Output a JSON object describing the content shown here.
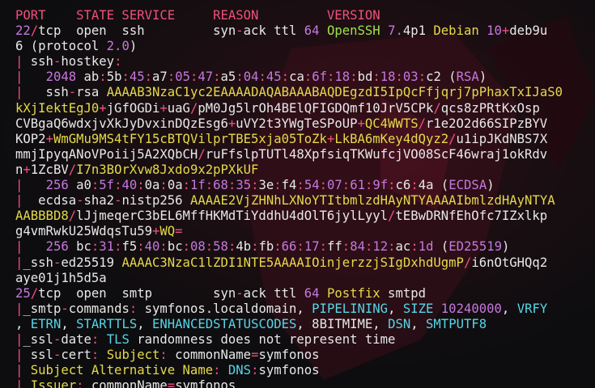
{
  "colors": {
    "background": "#0d0d0f",
    "text": "#e8e8e8",
    "red": "#f0507a",
    "purple": "#c678dd",
    "cyan": "#56d6e6",
    "green": "#a0e04a",
    "yellow": "#e5d94a"
  },
  "lines": [
    [
      [
        "PORT    STATE SERVICE     REASON         VERSION",
        "r"
      ]
    ],
    [
      [
        "22",
        "p"
      ],
      [
        "/",
        "r"
      ],
      [
        "tcp  open  ssh         syn",
        "w"
      ],
      [
        "-",
        "r"
      ],
      [
        "ack ttl ",
        "w"
      ],
      [
        "64",
        "p"
      ],
      [
        " OpenSSH ",
        "g"
      ],
      [
        "7.",
        "p"
      ],
      [
        "4p1 ",
        "w"
      ],
      [
        "Debian ",
        "y"
      ],
      [
        "10",
        "p"
      ],
      [
        "+",
        "r"
      ],
      [
        "deb9u",
        "w"
      ]
    ],
    [
      [
        "6 (protocol ",
        "w"
      ],
      [
        "2.0",
        "p"
      ],
      [
        ")",
        "w"
      ]
    ],
    [
      [
        "| ",
        "r"
      ],
      [
        "ssh",
        "w"
      ],
      [
        "-",
        "r"
      ],
      [
        "hostkey",
        "w"
      ],
      [
        ":",
        "r"
      ]
    ],
    [
      [
        "|   ",
        "r"
      ],
      [
        "2048",
        "p"
      ],
      [
        " ab",
        "w"
      ],
      [
        ":",
        "r"
      ],
      [
        "5b",
        "w"
      ],
      [
        ":",
        "r"
      ],
      [
        "45",
        "p"
      ],
      [
        ":",
        "r"
      ],
      [
        "a7",
        "w"
      ],
      [
        ":",
        "r"
      ],
      [
        "05",
        "p"
      ],
      [
        ":",
        "r"
      ],
      [
        "47",
        "p"
      ],
      [
        ":",
        "r"
      ],
      [
        "a5",
        "w"
      ],
      [
        ":",
        "r"
      ],
      [
        "04",
        "p"
      ],
      [
        ":",
        "r"
      ],
      [
        "45",
        "p"
      ],
      [
        ":",
        "r"
      ],
      [
        "ca",
        "w"
      ],
      [
        ":",
        "r"
      ],
      [
        "6f",
        "p"
      ],
      [
        ":",
        "r"
      ],
      [
        "18",
        "p"
      ],
      [
        ":",
        "r"
      ],
      [
        "bd",
        "w"
      ],
      [
        ":",
        "r"
      ],
      [
        "18",
        "p"
      ],
      [
        ":",
        "r"
      ],
      [
        "03",
        "p"
      ],
      [
        ":",
        "r"
      ],
      [
        "c2 (",
        "w"
      ],
      [
        "RSA",
        "p"
      ],
      [
        ")",
        "w"
      ]
    ],
    [
      [
        "| ",
        "r"
      ],
      [
        "  ssh",
        "w"
      ],
      [
        "-",
        "r"
      ],
      [
        "rsa ",
        "w"
      ],
      [
        "AAAAB3NzaC1yc2EAAAADAQABAAABAQDEgzdI5IpQcFfjqrj7pPhaxTxIJaS0",
        "y"
      ]
    ],
    [
      [
        "kXjIektEgJ0",
        "y"
      ],
      [
        "+",
        "r"
      ],
      [
        "jGfOGDi",
        "w"
      ],
      [
        "+",
        "r"
      ],
      [
        "uaG",
        "w"
      ],
      [
        "/",
        "r"
      ],
      [
        "pM0Jg5lrOh4BElQFIGDQmf10JrV5CPk",
        "w"
      ],
      [
        "/",
        "r"
      ],
      [
        "qcs8zPRtKxOsp",
        "w"
      ]
    ],
    [
      [
        "CVBgaQ6wdxjvXkJyDvxinDQzEsg6",
        "w"
      ],
      [
        "+",
        "r"
      ],
      [
        "uVY2t3YWgTeSPoUP",
        "w"
      ],
      [
        "+",
        "r"
      ],
      [
        "QC4WWTS",
        "y"
      ],
      [
        "/",
        "r"
      ],
      [
        "r1e2O2d66SIPzBYV",
        "w"
      ]
    ],
    [
      [
        "KOP2",
        "w"
      ],
      [
        "+",
        "r"
      ],
      [
        "WmGMu9MS4tFY15cBTQVilprTBE5xja05ToZk",
        "y"
      ],
      [
        "+",
        "r"
      ],
      [
        "LkBA6mKey4dQyz2",
        "y"
      ],
      [
        "/",
        "r"
      ],
      [
        "u1ipJKdNBS7X",
        "w"
      ]
    ],
    [
      [
        "mmjIpyqANoVPoiij5A2XQbCH",
        "w"
      ],
      [
        "/",
        "r"
      ],
      [
        "ruFfslpTUTl48XpfsiqTKWufcjVO08ScF46wraj1okRdv",
        "w"
      ]
    ],
    [
      [
        "n",
        "w"
      ],
      [
        "+",
        "r"
      ],
      [
        "1ZcBV",
        "w"
      ],
      [
        "/",
        "r"
      ],
      [
        "I7n3BOrXvw8Jxdo9x2pPXkUF",
        "y"
      ]
    ],
    [
      [
        "|   ",
        "r"
      ],
      [
        "256",
        "p"
      ],
      [
        " a0",
        "w"
      ],
      [
        ":",
        "r"
      ],
      [
        "5f",
        "p"
      ],
      [
        ":",
        "r"
      ],
      [
        "40",
        "p"
      ],
      [
        ":",
        "r"
      ],
      [
        "0a",
        "w"
      ],
      [
        ":",
        "r"
      ],
      [
        "0a",
        "w"
      ],
      [
        ":",
        "r"
      ],
      [
        "1f",
        "p"
      ],
      [
        ":",
        "r"
      ],
      [
        "68",
        "p"
      ],
      [
        ":",
        "r"
      ],
      [
        "35",
        "p"
      ],
      [
        ":",
        "r"
      ],
      [
        "3e",
        "w"
      ],
      [
        ":",
        "r"
      ],
      [
        "f4",
        "w"
      ],
      [
        ":",
        "r"
      ],
      [
        "54",
        "p"
      ],
      [
        ":",
        "r"
      ],
      [
        "07",
        "p"
      ],
      [
        ":",
        "r"
      ],
      [
        "61",
        "p"
      ],
      [
        ":",
        "r"
      ],
      [
        "9f",
        "p"
      ],
      [
        ":",
        "r"
      ],
      [
        "c6",
        "w"
      ],
      [
        ":",
        "r"
      ],
      [
        "4a (",
        "w"
      ],
      [
        "ECDSA",
        "p"
      ],
      [
        ")",
        "w"
      ]
    ],
    [
      [
        "| ",
        "r"
      ],
      [
        " ecdsa",
        "w"
      ],
      [
        "-",
        "r"
      ],
      [
        "sha2",
        "w"
      ],
      [
        "-",
        "r"
      ],
      [
        "nistp256 ",
        "w"
      ],
      [
        "AAAAE2VjZHNhLXNoYTItbmlzdHAyNTYAAAAIbmlzdHAyNTYA",
        "y"
      ]
    ],
    [
      [
        "AABBBD8",
        "y"
      ],
      [
        "/",
        "r"
      ],
      [
        "lJjmeqerC3bEL6MffHKMdTiYddhU4dOlT6jylLyyl",
        "w"
      ],
      [
        "/",
        "r"
      ],
      [
        "tEBwDRNfEhOfc7IZxlkp",
        "w"
      ]
    ],
    [
      [
        "g4vmRwkU25WdqsTu59",
        "w"
      ],
      [
        "+",
        "r"
      ],
      [
        "WQ",
        "y"
      ],
      [
        "=",
        "r"
      ]
    ],
    [
      [
        "|   ",
        "r"
      ],
      [
        "256",
        "p"
      ],
      [
        " bc",
        "w"
      ],
      [
        ":",
        "r"
      ],
      [
        "31",
        "p"
      ],
      [
        ":",
        "r"
      ],
      [
        "f5",
        "w"
      ],
      [
        ":",
        "r"
      ],
      [
        "40",
        "p"
      ],
      [
        ":",
        "r"
      ],
      [
        "bc",
        "w"
      ],
      [
        ":",
        "r"
      ],
      [
        "08",
        "p"
      ],
      [
        ":",
        "r"
      ],
      [
        "58",
        "p"
      ],
      [
        ":",
        "r"
      ],
      [
        "4b",
        "w"
      ],
      [
        ":",
        "r"
      ],
      [
        "fb",
        "w"
      ],
      [
        ":",
        "r"
      ],
      [
        "66",
        "p"
      ],
      [
        ":",
        "r"
      ],
      [
        "17",
        "p"
      ],
      [
        ":",
        "r"
      ],
      [
        "ff",
        "w"
      ],
      [
        ":",
        "r"
      ],
      [
        "84",
        "p"
      ],
      [
        ":",
        "r"
      ],
      [
        "12",
        "p"
      ],
      [
        ":",
        "r"
      ],
      [
        "ac",
        "w"
      ],
      [
        ":",
        "r"
      ],
      [
        "1d",
        "p"
      ],
      [
        " (",
        "w"
      ],
      [
        "ED25519",
        "p"
      ],
      [
        ")",
        "w"
      ]
    ],
    [
      [
        "|",
        "r"
      ],
      [
        "_ssh",
        "w"
      ],
      [
        "-",
        "r"
      ],
      [
        "ed25519 ",
        "w"
      ],
      [
        "AAAAC3NzaC1lZDI1NTE5AAAAIOinjerzzjSIgDxhdUgmP",
        "y"
      ],
      [
        "/",
        "r"
      ],
      [
        "i6nOtGHQq2",
        "w"
      ]
    ],
    [
      [
        "aye01j1h5d5a",
        "w"
      ]
    ],
    [
      [
        "25",
        "p"
      ],
      [
        "/",
        "r"
      ],
      [
        "tcp  open  smtp        syn",
        "w"
      ],
      [
        "-",
        "r"
      ],
      [
        "ack ttl ",
        "w"
      ],
      [
        "64",
        "p"
      ],
      [
        " Postfix",
        "y"
      ],
      [
        " smtpd",
        "w"
      ]
    ],
    [
      [
        "|",
        "r"
      ],
      [
        "_smtp",
        "w"
      ],
      [
        "-",
        "r"
      ],
      [
        "commands",
        "w"
      ],
      [
        ":",
        "r"
      ],
      [
        " symfonos.localdomain, ",
        "w"
      ],
      [
        "PIPELINING",
        "c"
      ],
      [
        ", ",
        "w"
      ],
      [
        "SIZE",
        "c"
      ],
      [
        " ",
        "w"
      ],
      [
        "10240000",
        "p"
      ],
      [
        ", ",
        "w"
      ],
      [
        "VRFY",
        "c"
      ]
    ],
    [
      [
        ", ",
        "w"
      ],
      [
        "ETRN",
        "c"
      ],
      [
        ", ",
        "w"
      ],
      [
        "STARTTLS",
        "c"
      ],
      [
        ", ",
        "w"
      ],
      [
        "ENHANCEDSTATUSCODES",
        "c"
      ],
      [
        ", 8BITMIME, ",
        "w"
      ],
      [
        "DSN",
        "c"
      ],
      [
        ", ",
        "w"
      ],
      [
        "SMTPUTF8",
        "c"
      ]
    ],
    [
      [
        "|",
        "r"
      ],
      [
        "_ssl",
        "w"
      ],
      [
        "-",
        "r"
      ],
      [
        "date",
        "w"
      ],
      [
        ":",
        "r"
      ],
      [
        " ",
        "w"
      ],
      [
        "TLS",
        "c"
      ],
      [
        " randomness does not represent time",
        "w"
      ]
    ],
    [
      [
        "| ",
        "r"
      ],
      [
        "ssl",
        "w"
      ],
      [
        "-",
        "r"
      ],
      [
        "cert",
        "w"
      ],
      [
        ":",
        "r"
      ],
      [
        " ",
        "w"
      ],
      [
        "Subject",
        "y"
      ],
      [
        ":",
        "r"
      ],
      [
        " commonName",
        "w"
      ],
      [
        "=",
        "r"
      ],
      [
        "symfonos",
        "w"
      ]
    ],
    [
      [
        "| ",
        "r"
      ],
      [
        "Subject Alternative Name",
        "y"
      ],
      [
        ":",
        "r"
      ],
      [
        " ",
        "w"
      ],
      [
        "DNS",
        "c"
      ],
      [
        ":",
        "r"
      ],
      [
        "symfonos",
        "w"
      ]
    ],
    [
      [
        "| ",
        "r"
      ],
      [
        "Issuer",
        "y"
      ],
      [
        ":",
        "r"
      ],
      [
        " commonName",
        "w"
      ],
      [
        "=",
        "r"
      ],
      [
        "symfonos",
        "w"
      ]
    ]
  ]
}
